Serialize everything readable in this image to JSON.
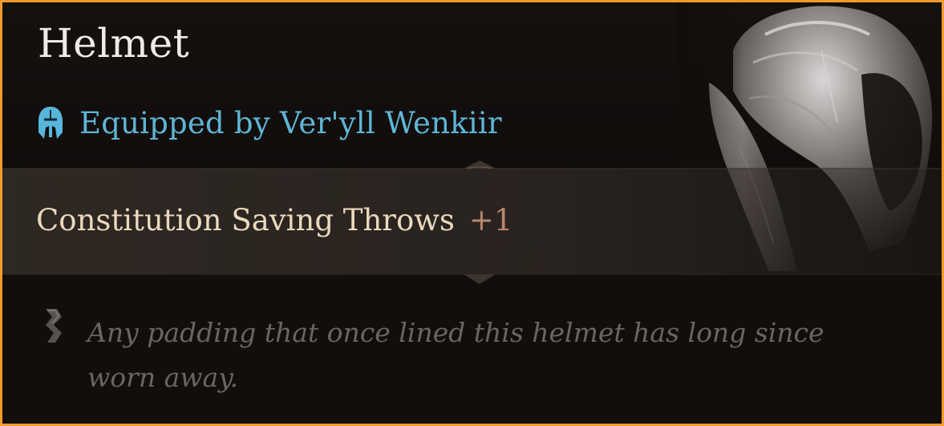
{
  "item": {
    "name": "Helmet",
    "equipped_by": "Equipped by Ver'yll Wenkiir",
    "stat": {
      "label": "Constitution Saving Throws",
      "value": "+1"
    },
    "description": "Any padding that once lined this helmet has long since worn away."
  },
  "icons": {
    "equip_icon": "helmet-icon",
    "lore_icon": "scroll-icon",
    "item_art": "helmet-illustration"
  },
  "colors": {
    "border": "#f19a2c",
    "title": "#efebe6",
    "equipped": "#5fb5d6",
    "stat_label": "#ead9bd",
    "stat_value": "#b9876b",
    "lore": "#6c655f"
  }
}
